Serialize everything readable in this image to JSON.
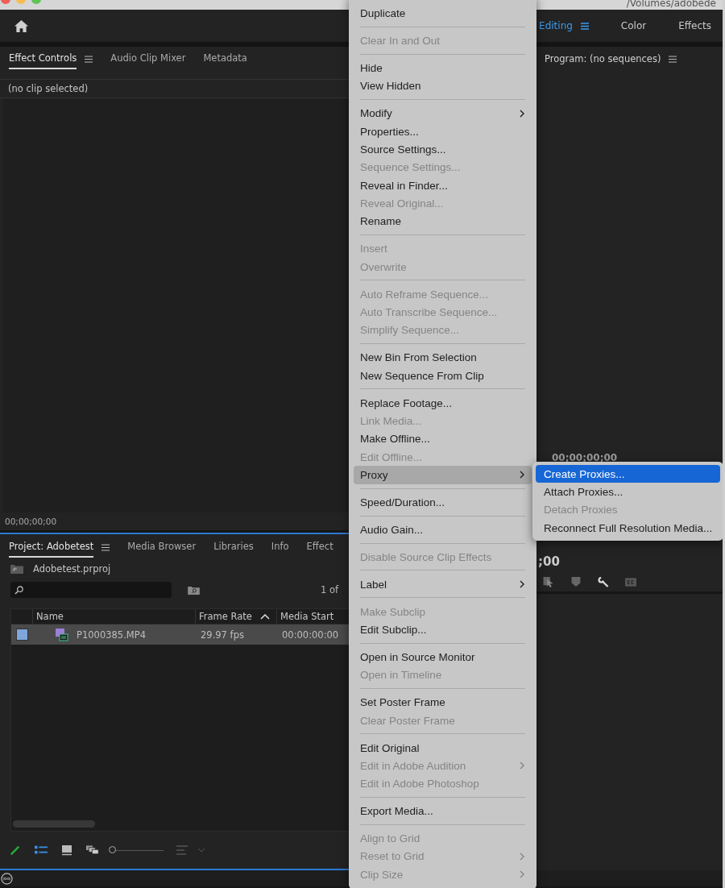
{
  "window": {
    "path": "/Volumes/adobede"
  },
  "workspaces": [
    {
      "label": "Editing",
      "selected": true
    },
    {
      "label": "Color",
      "selected": false
    },
    {
      "label": "Effects",
      "selected": false
    }
  ],
  "effect_panel": {
    "tabs": [
      {
        "label": "Effect Controls",
        "selected": true
      },
      {
        "label": "Audio Clip Mixer",
        "selected": false
      },
      {
        "label": "Metadata",
        "selected": false
      }
    ],
    "header": "(no clip selected)",
    "timecode": "00;00;00;00"
  },
  "program_monitor": {
    "title": "Program: (no sequences)",
    "timecode": "00;00;00;00",
    "timecode_cut": ";00"
  },
  "project_panel": {
    "tabs": [
      {
        "label": "Project: Adobetest",
        "selected": true
      },
      {
        "label": "Media Browser",
        "selected": false
      },
      {
        "label": "Libraries",
        "selected": false
      },
      {
        "label": "Info",
        "selected": false
      },
      {
        "label": "Effect",
        "selected": false
      }
    ],
    "project_file": "Adobetest.prproj",
    "item_count": "1 of",
    "zoom_slider": {
      "level": 0
    },
    "columns": [
      {
        "label": "Name",
        "sorted": false
      },
      {
        "label": "Frame Rate",
        "sorted": true
      },
      {
        "label": "Media Start",
        "sorted": false
      }
    ],
    "rows": [
      {
        "color": "#7fa6dc",
        "name": "P1000385.MP4",
        "frame_rate": "29.97 fps",
        "media_start": "00:00:00:00",
        "selected": true
      }
    ]
  },
  "context_menu": {
    "sections": [
      [
        {
          "label": "Duplicate",
          "disabled": false,
          "submenu": false,
          "selected": false
        }
      ],
      [
        {
          "label": "Clear In and Out",
          "disabled": true,
          "submenu": false,
          "selected": false
        }
      ],
      [
        {
          "label": "Hide",
          "disabled": false,
          "submenu": false,
          "selected": false
        },
        {
          "label": "View Hidden",
          "disabled": false,
          "submenu": false,
          "selected": false
        }
      ],
      [
        {
          "label": "Modify",
          "disabled": false,
          "submenu": true,
          "selected": false
        },
        {
          "label": "Properties...",
          "disabled": false,
          "submenu": false,
          "selected": false
        },
        {
          "label": "Source Settings...",
          "disabled": false,
          "submenu": false,
          "selected": false
        },
        {
          "label": "Sequence Settings...",
          "disabled": true,
          "submenu": false,
          "selected": false
        },
        {
          "label": "Reveal in Finder...",
          "disabled": false,
          "submenu": false,
          "selected": false
        },
        {
          "label": "Reveal Original...",
          "disabled": true,
          "submenu": false,
          "selected": false
        },
        {
          "label": "Rename",
          "disabled": false,
          "submenu": false,
          "selected": false
        }
      ],
      [
        {
          "label": "Insert",
          "disabled": true,
          "submenu": false,
          "selected": false
        },
        {
          "label": "Overwrite",
          "disabled": true,
          "submenu": false,
          "selected": false
        }
      ],
      [
        {
          "label": "Auto Reframe Sequence...",
          "disabled": true,
          "submenu": false,
          "selected": false
        },
        {
          "label": "Auto Transcribe Sequence...",
          "disabled": true,
          "submenu": false,
          "selected": false
        },
        {
          "label": "Simplify Sequence...",
          "disabled": true,
          "submenu": false,
          "selected": false
        }
      ],
      [
        {
          "label": "New Bin From Selection",
          "disabled": false,
          "submenu": false,
          "selected": false
        },
        {
          "label": "New Sequence From Clip",
          "disabled": false,
          "submenu": false,
          "selected": false
        }
      ],
      [
        {
          "label": "Replace Footage...",
          "disabled": false,
          "submenu": false,
          "selected": false
        },
        {
          "label": "Link Media...",
          "disabled": true,
          "submenu": false,
          "selected": false
        },
        {
          "label": "Make Offline...",
          "disabled": false,
          "submenu": false,
          "selected": false
        },
        {
          "label": "Edit Offline...",
          "disabled": true,
          "submenu": false,
          "selected": false
        },
        {
          "label": "Proxy",
          "disabled": false,
          "submenu": true,
          "selected": true
        }
      ],
      [
        {
          "label": "Speed/Duration...",
          "disabled": false,
          "submenu": false,
          "selected": false
        }
      ],
      [
        {
          "label": "Audio Gain...",
          "disabled": false,
          "submenu": false,
          "selected": false
        }
      ],
      [
        {
          "label": "Disable Source Clip Effects",
          "disabled": true,
          "submenu": false,
          "selected": false
        }
      ],
      [
        {
          "label": "Label",
          "disabled": false,
          "submenu": true,
          "selected": false
        }
      ],
      [
        {
          "label": "Make Subclip",
          "disabled": true,
          "submenu": false,
          "selected": false
        },
        {
          "label": "Edit Subclip...",
          "disabled": false,
          "submenu": false,
          "selected": false
        }
      ],
      [
        {
          "label": "Open in Source Monitor",
          "disabled": false,
          "submenu": false,
          "selected": false
        },
        {
          "label": "Open in Timeline",
          "disabled": true,
          "submenu": false,
          "selected": false
        }
      ],
      [
        {
          "label": "Set Poster Frame",
          "disabled": false,
          "submenu": false,
          "selected": false
        },
        {
          "label": "Clear Poster Frame",
          "disabled": true,
          "submenu": false,
          "selected": false
        }
      ],
      [
        {
          "label": "Edit Original",
          "disabled": false,
          "submenu": false,
          "selected": false
        },
        {
          "label": "Edit in Adobe Audition",
          "disabled": true,
          "submenu": true,
          "selected": false
        },
        {
          "label": "Edit in Adobe Photoshop",
          "disabled": true,
          "submenu": false,
          "selected": false
        }
      ],
      [
        {
          "label": "Export Media...",
          "disabled": false,
          "submenu": false,
          "selected": false
        }
      ],
      [
        {
          "label": "Align to Grid",
          "disabled": true,
          "submenu": false,
          "selected": false
        },
        {
          "label": "Reset to Grid",
          "disabled": true,
          "submenu": true,
          "selected": false
        },
        {
          "label": "Clip Size",
          "disabled": true,
          "submenu": true,
          "selected": false
        }
      ]
    ]
  },
  "proxy_submenu": {
    "items": [
      {
        "label": "Create Proxies...",
        "disabled": false,
        "selected": true
      },
      {
        "label": "Attach Proxies...",
        "disabled": false,
        "selected": false
      },
      {
        "label": "Detach Proxies",
        "disabled": true,
        "selected": false
      },
      {
        "label": "Reconnect Full Resolution Media...",
        "disabled": false,
        "selected": false
      }
    ]
  }
}
